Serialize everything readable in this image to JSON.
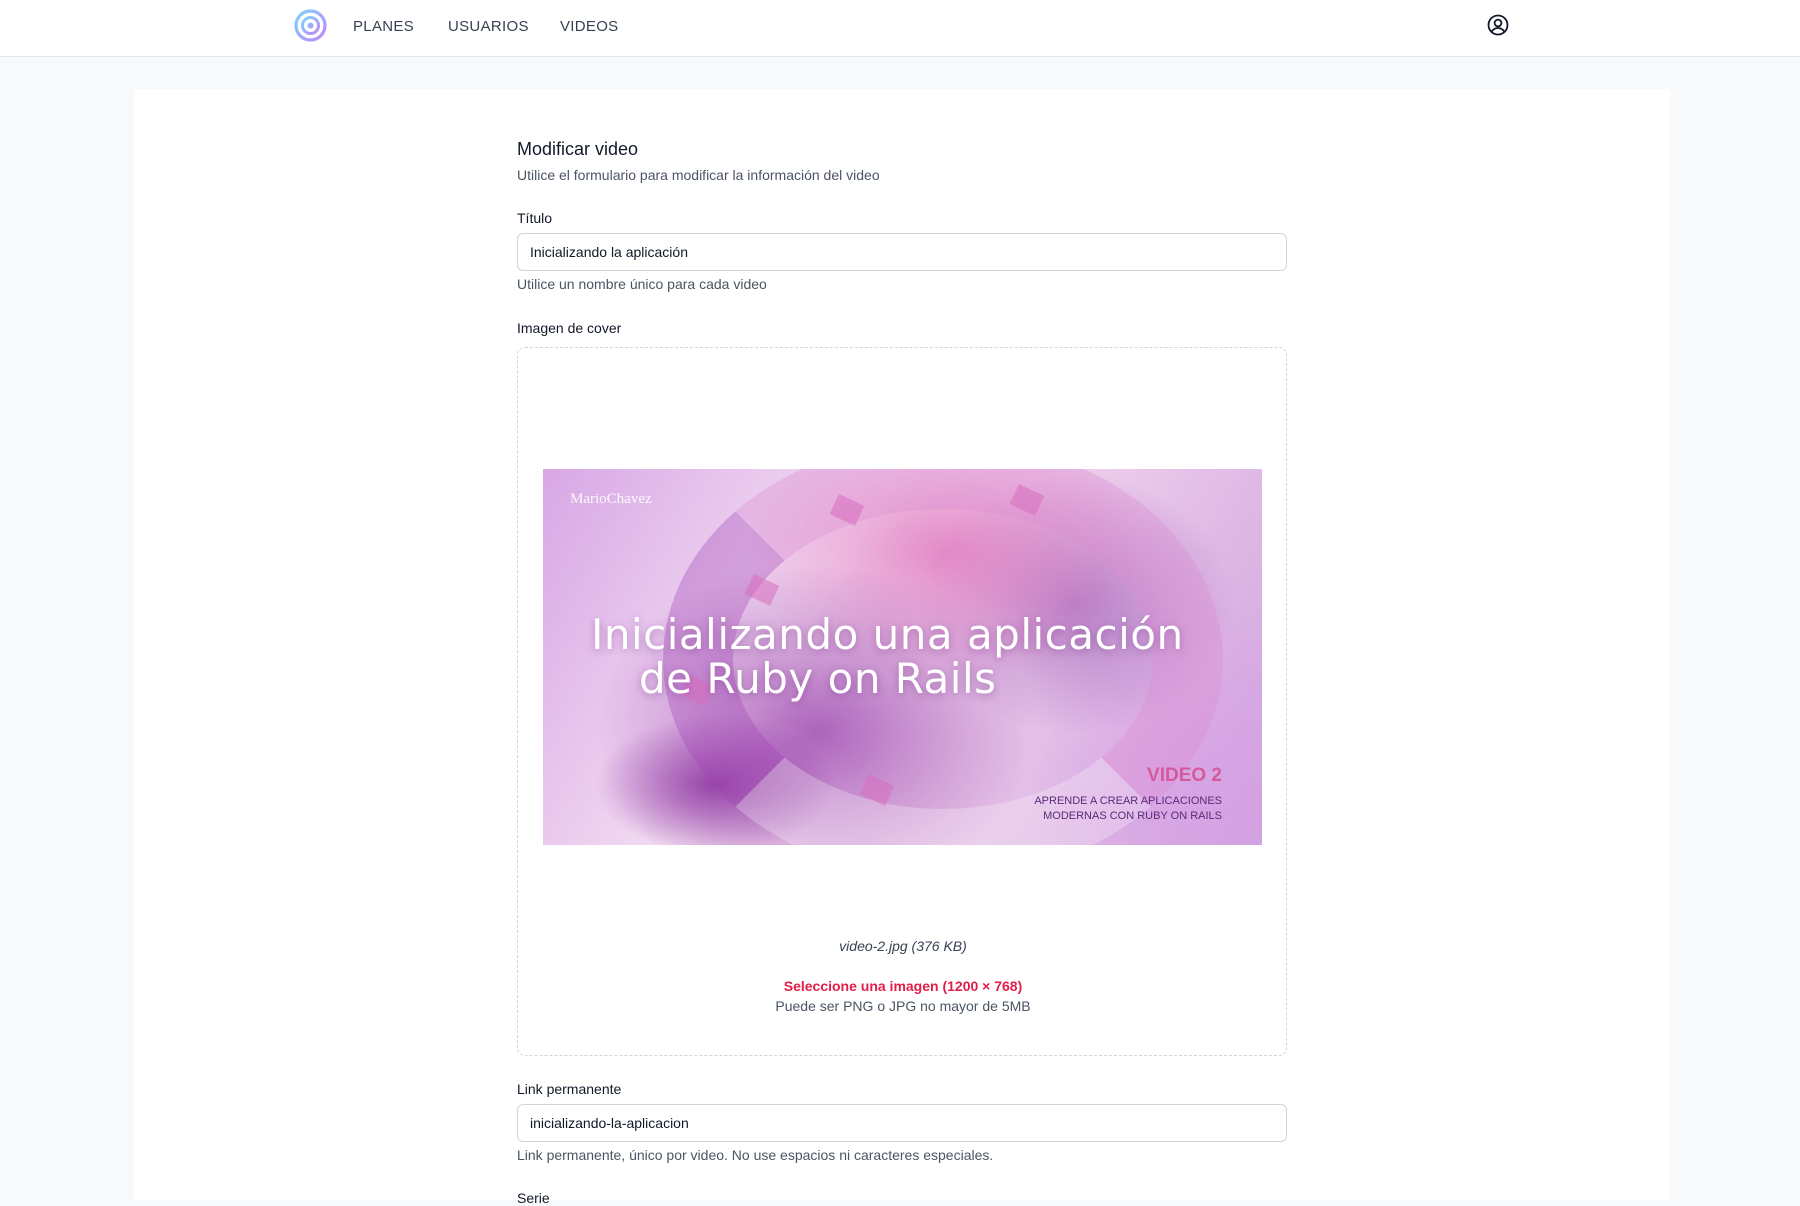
{
  "nav": {
    "links": [
      "PLANES",
      "USUARIOS",
      "VIDEOS"
    ]
  },
  "form": {
    "title": "Modificar video",
    "subtitle": "Utilice el formulario para modificar la información del video",
    "titulo": {
      "label": "Título",
      "value": "Inicializando la aplicación",
      "help": "Utilice un nombre único para cada video"
    },
    "cover": {
      "label": "Imagen de cover",
      "image": {
        "brand": "MarioChavez",
        "title_line1": "Inicializando una aplicación",
        "title_line2": "de Ruby on Rails",
        "video_tag": "VIDEO 2",
        "subtitle_line1": "APRENDE A CREAR APLICACIONES",
        "subtitle_line2": "MODERNAS CON RUBY ON RAILS"
      },
      "file_name": "video-2.jpg (376 KB)",
      "select_label": "Seleccione una imagen (1200 × 768)",
      "select_hint": "Puede ser PNG o JPG no mayor de 5MB"
    },
    "link": {
      "label": "Link permanente",
      "value": "inicializando-la-aplicacion",
      "help": "Link permanente, único por video. No use espacios ni caracteres especiales."
    },
    "serie": {
      "label": "Serie"
    }
  },
  "colors": {
    "accent": "#e11d48",
    "logo_gradient_start": "#7dd3fc",
    "logo_gradient_end": "#a78bfa"
  }
}
